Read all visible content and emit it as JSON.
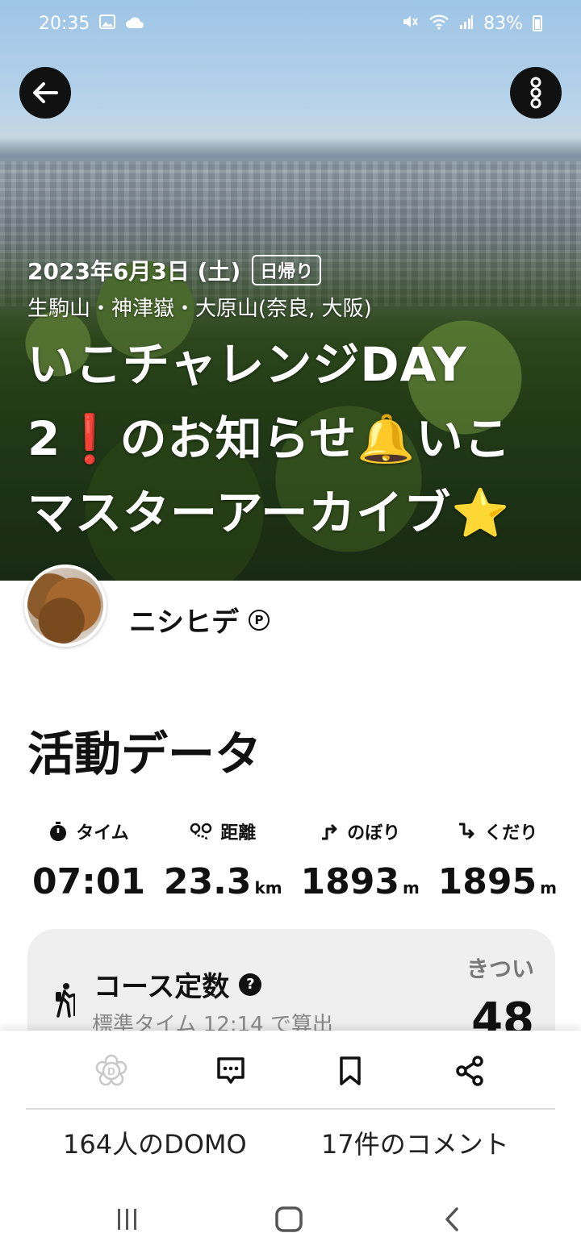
{
  "status_bar": {
    "time": "20:35",
    "left_icons": [
      "gallery-icon",
      "cloud-icon"
    ],
    "battery": "83%",
    "right_icons": [
      "mute-icon",
      "wifi-icon",
      "signal-icon",
      "battery-icon"
    ]
  },
  "hero": {
    "date": "2023年6月3日 (土)",
    "tag": "日帰り",
    "mountains": "生駒山・神津嶽・大原山(奈良, 大阪)",
    "title_line1": "いこチャレンジDAY",
    "title_line2": "2❗のお知らせ🔔いこ",
    "title_line3": "マスターアーカイブ⭐"
  },
  "author": {
    "name": "ニシヒデ",
    "badge": "P"
  },
  "activity": {
    "section_title": "活動データ",
    "stats": [
      {
        "label": "タイム",
        "value": "07:01",
        "unit": "",
        "icon": "stopwatch-icon"
      },
      {
        "label": "距離",
        "value": "23.3",
        "unit": "km",
        "icon": "route-icon"
      },
      {
        "label": "のぼり",
        "value": "1893",
        "unit": "m",
        "icon": "ascent-icon"
      },
      {
        "label": "くだり",
        "value": "1895",
        "unit": "m",
        "icon": "descent-icon"
      }
    ]
  },
  "course": {
    "title": "コース定数",
    "help": "?",
    "subtitle": "標準タイム 12:14 で算出",
    "difficulty": "きつい",
    "value": "48"
  },
  "actions": {
    "icons": [
      "domo-icon",
      "comment-icon",
      "bookmark-icon",
      "share-icon"
    ],
    "domo_count": "164人のDOMO",
    "comment_count": "17件のコメント"
  },
  "nav": {
    "icons": [
      "recent-apps-icon",
      "home-icon",
      "back-nav-icon"
    ]
  },
  "colors": {
    "accent": "#111111",
    "card_bg": "#efefef",
    "muted": "#888888"
  }
}
